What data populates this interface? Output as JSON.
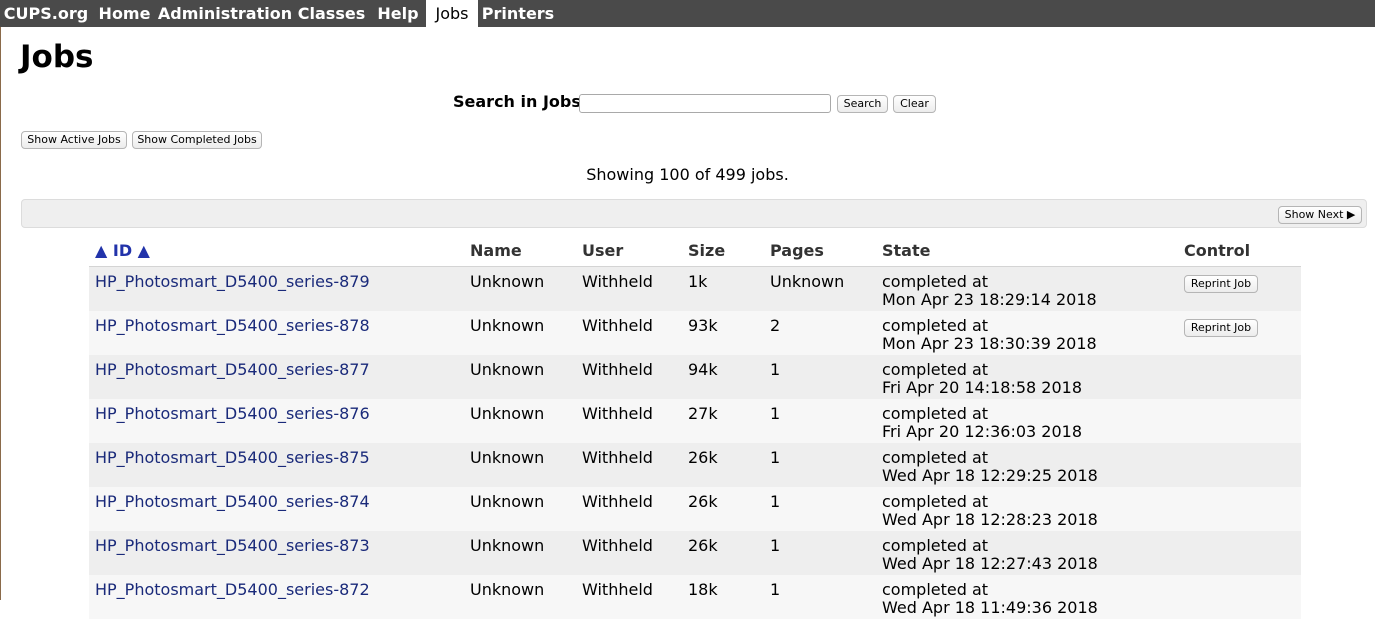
{
  "nav": {
    "items": [
      {
        "label": "CUPS.org",
        "active": false
      },
      {
        "label": "Home",
        "active": false
      },
      {
        "label": "Administration",
        "active": false
      },
      {
        "label": "Classes",
        "active": false
      },
      {
        "label": "Help",
        "active": false
      },
      {
        "label": "Jobs",
        "active": true
      },
      {
        "label": "Printers",
        "active": false
      }
    ]
  },
  "page": {
    "title": "Jobs"
  },
  "search": {
    "label": "Search in Jobs:",
    "value": "",
    "search_button": "Search",
    "clear_button": "Clear"
  },
  "filters": {
    "active_button": "Show Active Jobs",
    "completed_button": "Show Completed Jobs"
  },
  "summary": "Showing 100 of 499 jobs.",
  "pager": {
    "next_button": "Show Next ▶"
  },
  "table": {
    "columns": [
      "▲ ID ▲",
      "Name",
      "User",
      "Size",
      "Pages",
      "State",
      "Control"
    ],
    "rows": [
      {
        "id": "HP_Photosmart_D5400_series-879",
        "name": "Unknown",
        "user": "Withheld",
        "size": "1k",
        "pages": "Unknown",
        "state_line1": "completed at",
        "state_line2": "Mon Apr 23 18:29:14 2018",
        "control": "Reprint Job"
      },
      {
        "id": "HP_Photosmart_D5400_series-878",
        "name": "Unknown",
        "user": "Withheld",
        "size": "93k",
        "pages": "2",
        "state_line1": "completed at",
        "state_line2": "Mon Apr 23 18:30:39 2018",
        "control": "Reprint Job"
      },
      {
        "id": "HP_Photosmart_D5400_series-877",
        "name": "Unknown",
        "user": "Withheld",
        "size": "94k",
        "pages": "1",
        "state_line1": "completed at",
        "state_line2": "Fri Apr 20 14:18:58 2018",
        "control": ""
      },
      {
        "id": "HP_Photosmart_D5400_series-876",
        "name": "Unknown",
        "user": "Withheld",
        "size": "27k",
        "pages": "1",
        "state_line1": "completed at",
        "state_line2": "Fri Apr 20 12:36:03 2018",
        "control": ""
      },
      {
        "id": "HP_Photosmart_D5400_series-875",
        "name": "Unknown",
        "user": "Withheld",
        "size": "26k",
        "pages": "1",
        "state_line1": "completed at",
        "state_line2": "Wed Apr 18 12:29:25 2018",
        "control": ""
      },
      {
        "id": "HP_Photosmart_D5400_series-874",
        "name": "Unknown",
        "user": "Withheld",
        "size": "26k",
        "pages": "1",
        "state_line1": "completed at",
        "state_line2": "Wed Apr 18 12:28:23 2018",
        "control": ""
      },
      {
        "id": "HP_Photosmart_D5400_series-873",
        "name": "Unknown",
        "user": "Withheld",
        "size": "26k",
        "pages": "1",
        "state_line1": "completed at",
        "state_line2": "Wed Apr 18 12:27:43 2018",
        "control": ""
      },
      {
        "id": "HP_Photosmart_D5400_series-872",
        "name": "Unknown",
        "user": "Withheld",
        "size": "18k",
        "pages": "1",
        "state_line1": "completed at",
        "state_line2": "Wed Apr 18 11:49:36 2018",
        "control": ""
      }
    ]
  }
}
